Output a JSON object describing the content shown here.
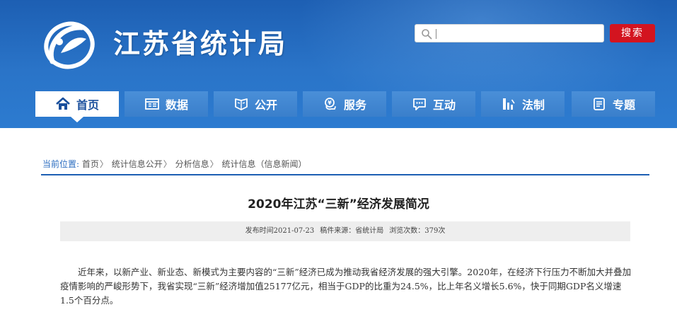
{
  "header": {
    "site_title": "江苏省统计局",
    "search": {
      "placeholder": "",
      "button_label": "搜索"
    },
    "colors": {
      "header_blue": "#1d5fb3",
      "search_red": "#d3141f",
      "nav_blue": "#3a7fcb"
    }
  },
  "nav": {
    "items": [
      {
        "label": "首页",
        "icon": "home-icon",
        "active": true
      },
      {
        "label": "数据",
        "icon": "data-table-icon",
        "active": false
      },
      {
        "label": "公开",
        "icon": "open-shield-icon",
        "active": false
      },
      {
        "label": "服务",
        "icon": "service-icon",
        "active": false
      },
      {
        "label": "互动",
        "icon": "chat-icon",
        "active": false
      },
      {
        "label": "法制",
        "icon": "law-bars-icon",
        "active": false
      },
      {
        "label": "专题",
        "icon": "topic-doc-icon",
        "active": false
      }
    ]
  },
  "breadcrumb": {
    "lead": "当前位置:",
    "items": [
      "首页",
      "统计信息公开",
      "分析信息",
      "统计信息（信息新闻）"
    ],
    "separator": "〉"
  },
  "article": {
    "title": "2020年江苏“三新”经济发展简况",
    "meta": {
      "publish_time": "发布时间2021-07-23",
      "source": "稿件来源：省统计局",
      "views": "浏览次数：379次"
    },
    "paragraph": "近年来，以新产业、新业态、新模式为主要内容的“三新”经济已成为推动我省经济发展的强大引擎。2020年，在经济下行压力不断加大并叠加疫情影响的严峻形势下，我省实现“三新”经济增加值25177亿元，相当于GDP的比重为24.5%，比上年名义增长5.6%，快于同期GDP名义增速1.5个百分点。"
  }
}
